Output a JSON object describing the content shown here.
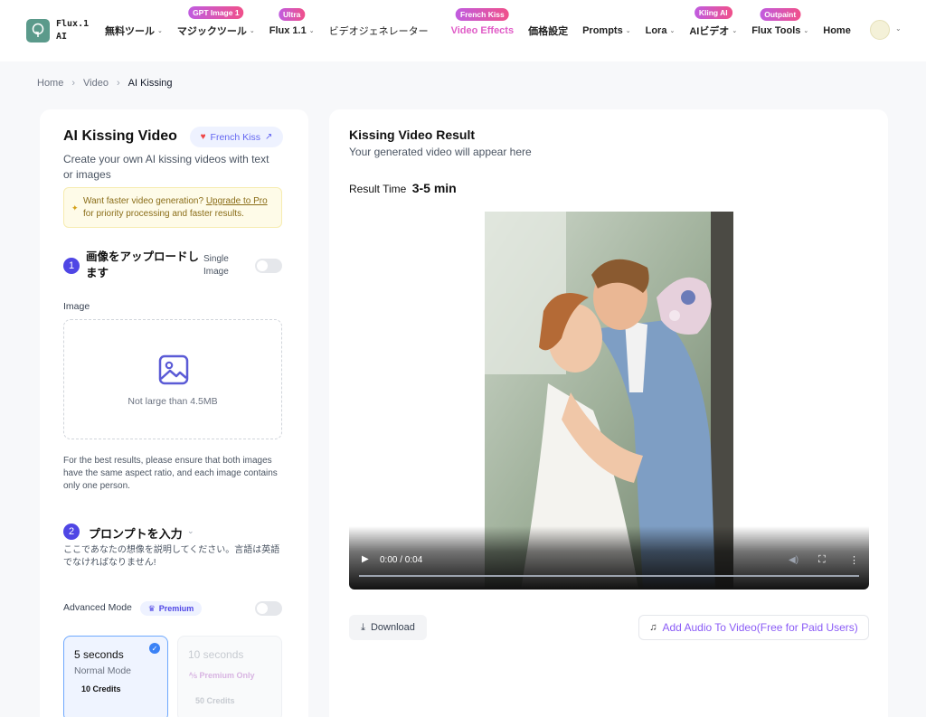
{
  "brand": {
    "name_line1": "Flux.1",
    "name_line2": "AI"
  },
  "nav": {
    "items": [
      {
        "label": "無料ツール",
        "chevron": true
      },
      {
        "label": "マジックツール",
        "chevron": true,
        "badge": "GPT Image 1"
      },
      {
        "label": "Flux 1.1",
        "chevron": true,
        "badge": "Ultra"
      },
      {
        "label": "ビデオジェネレーター",
        "chevron": false
      },
      {
        "label": "Video Effects",
        "chevron": false,
        "badge": "French Kiss",
        "active": true
      },
      {
        "label": "価格設定",
        "chevron": false
      },
      {
        "label": "Prompts",
        "chevron": true
      },
      {
        "label": "Lora",
        "chevron": true
      },
      {
        "label": "AIビデオ",
        "chevron": true,
        "badge": "Kling AI"
      },
      {
        "label": "Flux Tools",
        "chevron": true,
        "badge": "Outpaint"
      },
      {
        "label": "Home",
        "chevron": false
      }
    ]
  },
  "breadcrumb": {
    "home": "Home",
    "video": "Video",
    "current": "AI Kissing"
  },
  "left": {
    "title": "AI Kissing Video",
    "french_kiss_label": "French Kiss",
    "description": "Create your own AI kissing videos with text or images",
    "upgrade": {
      "prefix": "Want faster video generation?",
      "link": "Upgrade to Pro",
      "suffix": "for priority processing and faster results."
    },
    "step1": {
      "number": "1",
      "title": "画像をアップロードします",
      "single_image_label": "Single Image",
      "single_image_on": false
    },
    "image_label": "Image",
    "dropzone_text": "Not large than 4.5MB",
    "tip": "For the best results, please ensure that both images have the same aspect ratio, and each image contains only one person.",
    "step2": {
      "number": "2",
      "title": "プロンプトを入力",
      "description": "ここであなたの想像を説明してください。言語は英語でなければなりません!"
    },
    "advanced_label": "Advanced Mode",
    "premium_label": "Premium",
    "advanced_on": false,
    "options": [
      {
        "seconds": "5 seconds",
        "mode": "Normal Mode",
        "credits": "10 Credits",
        "selected": true
      },
      {
        "seconds": "10 seconds",
        "premium_only": "Premium Only",
        "credits": "50 Credits",
        "selected": false
      }
    ]
  },
  "right": {
    "title": "Kissing Video Result",
    "subtitle": "Your generated video will appear here",
    "result_time_label": "Result Time",
    "result_time_value": "3-5 min",
    "video": {
      "time": "0:00 / 0:04",
      "progress": 0
    },
    "download_label": "Download",
    "audio_label": "Add Audio To Video(Free for Paid Users)"
  },
  "colors": {
    "accent": "#4f46e5",
    "active_nav": "#e05cc7",
    "audio_text": "#8b5cf6",
    "badge_start": "#c05ce0",
    "badge_end": "#f0508a"
  },
  "icons": {
    "logo": "tree-logo-icon",
    "french_kiss": "heart-icon",
    "external": "external-link-icon",
    "bolt": "bolt-icon",
    "image": "image-upload-icon",
    "crown": "crown-icon",
    "download": "download-icon",
    "music": "music-note-icon"
  }
}
